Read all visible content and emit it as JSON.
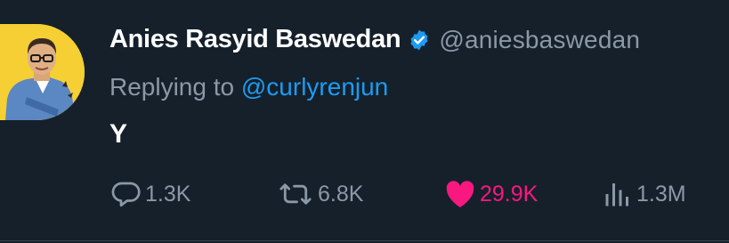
{
  "tweet": {
    "author_name": "Anies Rasyid Baswedan",
    "handle": "@aniesbaswedan",
    "replying_prefix": "Replying to",
    "replying_to": "@curlyrenjun",
    "text": "Y"
  },
  "actions": {
    "replies": "1.3K",
    "retweets": "6.8K",
    "likes": "29.9K",
    "views": "1.3M"
  },
  "icons": {
    "verified": "verified-badge-icon",
    "reply": "reply-icon",
    "retweet": "retweet-icon",
    "like": "heart-icon",
    "views": "views-icon"
  },
  "colors": {
    "background": "#15202b",
    "primary_text": "#ffffff",
    "secondary_text": "#8b98a5",
    "link": "#1d9bf0",
    "like_active": "#f91880",
    "avatar_bg": "#f5cf33"
  }
}
